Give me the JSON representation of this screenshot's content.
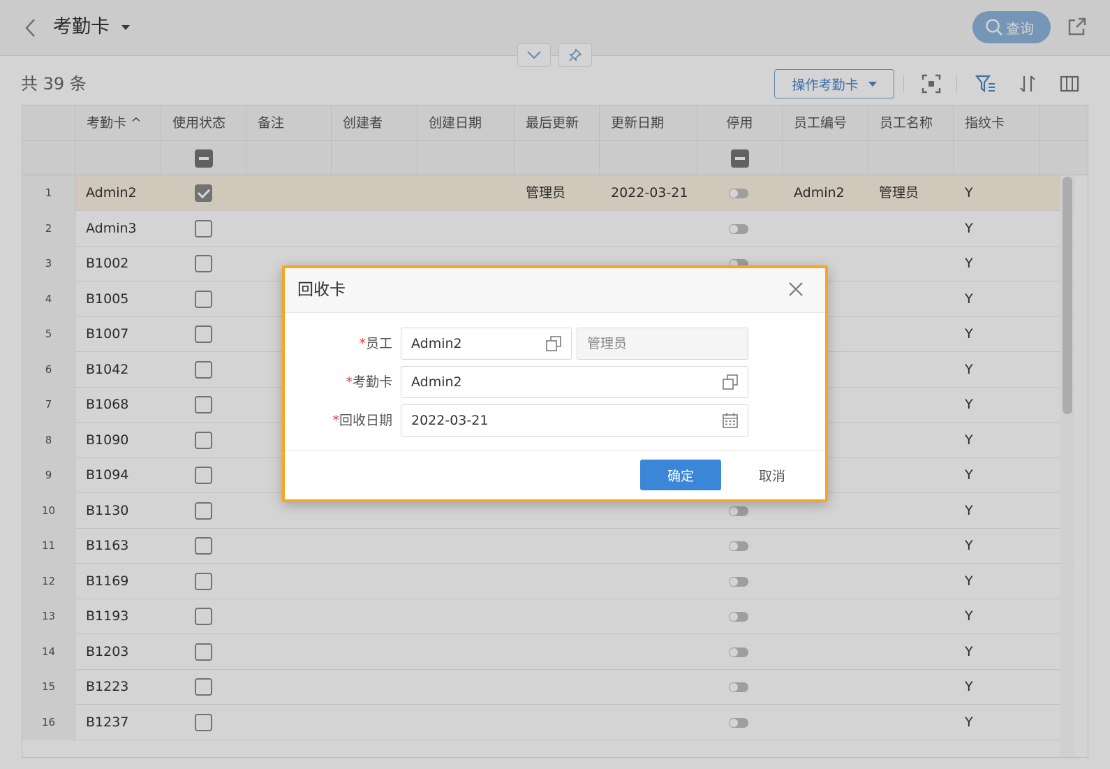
{
  "header": {
    "title": "考勤卡",
    "search_label": "查询"
  },
  "toolbar": {
    "total": "共 39 条",
    "operate_label": "操作考勤卡"
  },
  "columns": [
    "考勤卡 ^",
    "使用状态",
    "备注",
    "创建者",
    "创建日期",
    "最后更新",
    "更新日期",
    "停用",
    "员工编号",
    "员工名称",
    "指纹卡"
  ],
  "rows": [
    {
      "no": "1",
      "card": "Admin2",
      "in_use": true,
      "last_updated_by": "管理员",
      "update_date": "2022-03-21",
      "emp_no": "Admin2",
      "emp_name": "管理员",
      "fingerprint": "Y"
    },
    {
      "no": "2",
      "card": "Admin3",
      "in_use": false,
      "fingerprint": "Y"
    },
    {
      "no": "3",
      "card": "B1002",
      "in_use": false,
      "fingerprint": "Y"
    },
    {
      "no": "4",
      "card": "B1005",
      "in_use": false,
      "fingerprint": "Y"
    },
    {
      "no": "5",
      "card": "B1007",
      "in_use": false,
      "fingerprint": "Y"
    },
    {
      "no": "6",
      "card": "B1042",
      "in_use": false,
      "fingerprint": "Y"
    },
    {
      "no": "7",
      "card": "B1068",
      "in_use": false,
      "fingerprint": "Y"
    },
    {
      "no": "8",
      "card": "B1090",
      "in_use": false,
      "fingerprint": "Y"
    },
    {
      "no": "9",
      "card": "B1094",
      "in_use": false,
      "fingerprint": "Y"
    },
    {
      "no": "10",
      "card": "B1130",
      "in_use": false,
      "fingerprint": "Y"
    },
    {
      "no": "11",
      "card": "B1163",
      "in_use": false,
      "fingerprint": "Y"
    },
    {
      "no": "12",
      "card": "B1169",
      "in_use": false,
      "fingerprint": "Y"
    },
    {
      "no": "13",
      "card": "B1193",
      "in_use": false,
      "fingerprint": "Y"
    },
    {
      "no": "14",
      "card": "B1203",
      "in_use": false,
      "fingerprint": "Y"
    },
    {
      "no": "15",
      "card": "B1223",
      "in_use": false,
      "fingerprint": "Y"
    },
    {
      "no": "16",
      "card": "B1237",
      "in_use": false,
      "fingerprint": "Y"
    }
  ],
  "dialog": {
    "title": "回收卡",
    "employee_label": "员工",
    "employee_code": "Admin2",
    "employee_name": "管理员",
    "card_label": "考勤卡",
    "card_value": "Admin2",
    "date_label": "回收日期",
    "date_value": "2022-03-21",
    "ok_label": "确定",
    "cancel_label": "取消"
  },
  "colors": {
    "accent": "#3b86d6",
    "highlight": "#f5a623",
    "selected_row": "#faf1e0"
  }
}
